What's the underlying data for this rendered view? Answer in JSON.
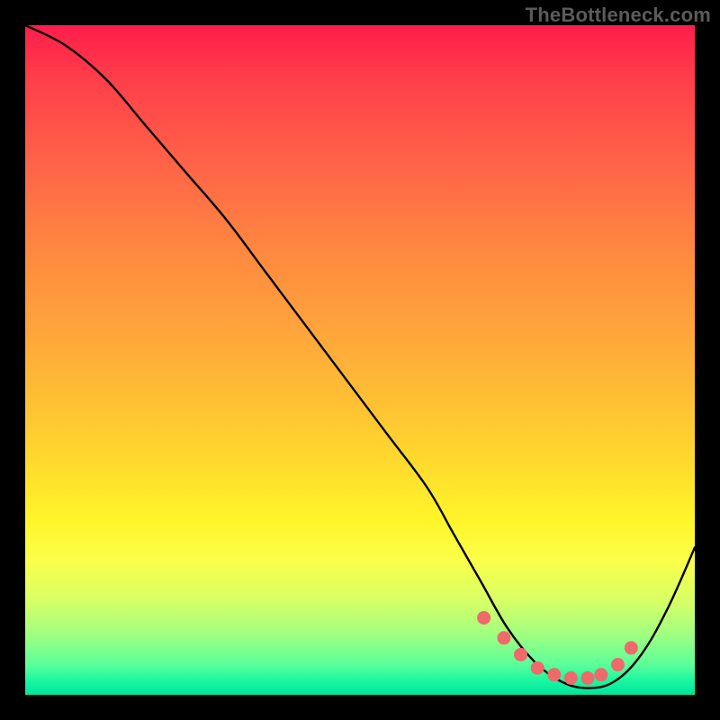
{
  "watermark": "TheBottleneck.com",
  "chart_data": {
    "type": "line",
    "title": "",
    "xlabel": "",
    "ylabel": "",
    "xlim": [
      0,
      100
    ],
    "ylim": [
      0,
      100
    ],
    "series": [
      {
        "name": "curve",
        "x": [
          0,
          6,
          12,
          18,
          24,
          30,
          36,
          42,
          48,
          54,
          60,
          64,
          68,
          72,
          76,
          80,
          84,
          88,
          92,
          96,
          100
        ],
        "values": [
          100,
          97,
          92,
          85,
          78,
          71,
          63,
          55,
          47,
          39,
          31,
          24,
          17,
          10,
          5,
          2,
          1,
          2,
          6,
          13,
          22
        ]
      }
    ],
    "markers": {
      "name": "dots",
      "color": "#ef6a6a",
      "x": [
        68.5,
        71.5,
        74,
        76.5,
        79,
        81.5,
        84,
        86,
        88.5,
        90.5
      ],
      "values": [
        11.5,
        8.5,
        6,
        4,
        3,
        2.5,
        2.5,
        3,
        4.5,
        7
      ]
    },
    "gradient_stops": [
      {
        "pos": 0,
        "color": "#ff1d4b"
      },
      {
        "pos": 50,
        "color": "#ffb93a"
      },
      {
        "pos": 78,
        "color": "#fff52a"
      },
      {
        "pos": 100,
        "color": "#02e39b"
      }
    ]
  }
}
